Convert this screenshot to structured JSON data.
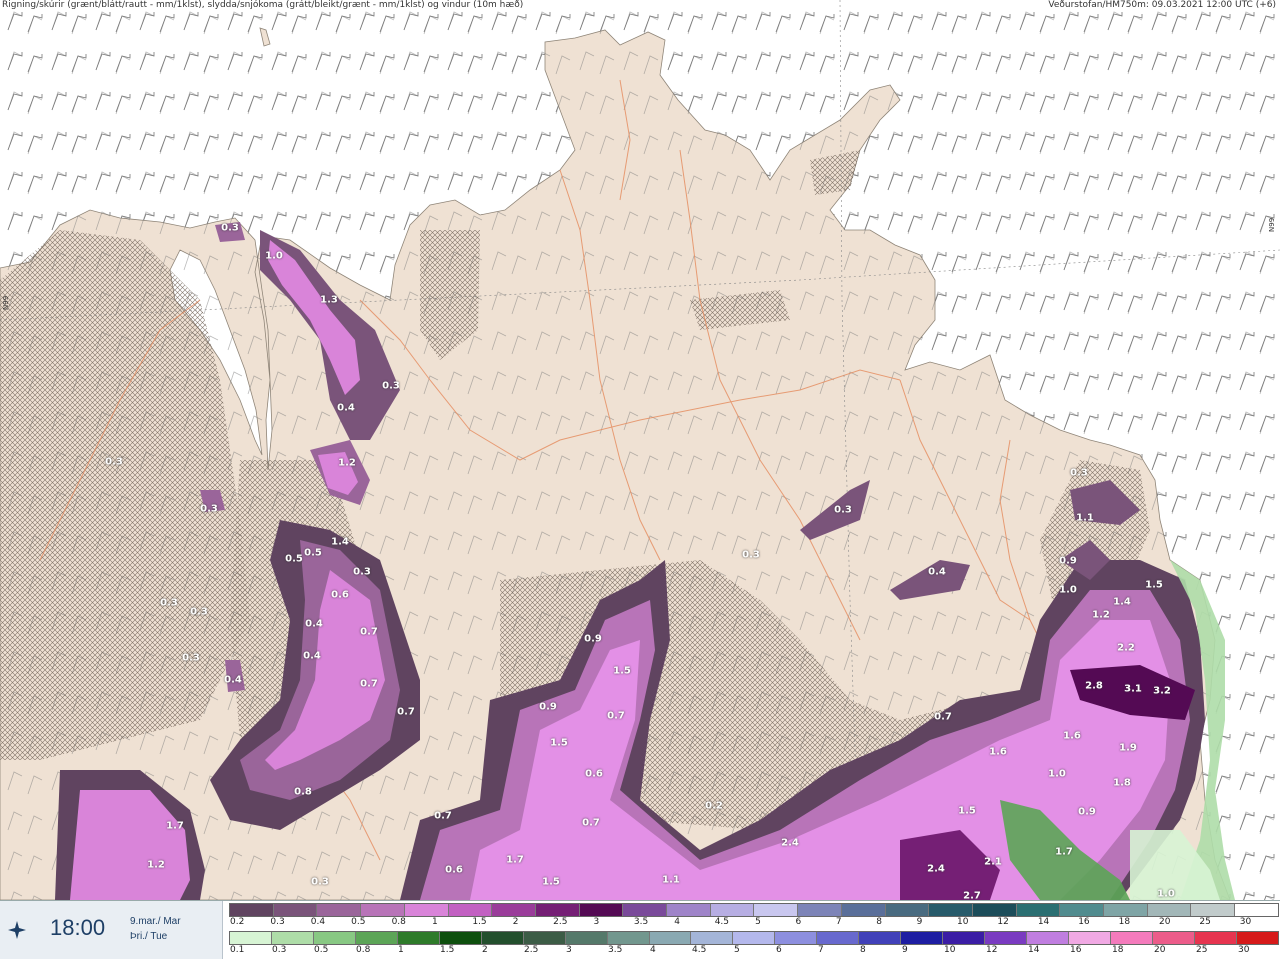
{
  "header": {
    "left_title": "Rigning/skúrir (grænt/blátt/rautt - mm/1klst), slydda/snjókoma (grátt/bleikt/grænt - mm/1klst) og vindur (10m hæð)",
    "right_title": "Veðurstofan/HM750m: 09.03.2021 12:00 UTC (+6)"
  },
  "map": {
    "lat_label_left": "N99",
    "lat_label_right": "N99",
    "land_color": "#efe1d3",
    "sea_color": "#ffffff",
    "precip_labels": [
      {
        "text": "0.3"
      },
      {
        "text": "1.0"
      },
      {
        "text": "1.3"
      },
      {
        "text": "0.3"
      },
      {
        "text": "0.4"
      },
      {
        "text": "1.2"
      },
      {
        "text": "0.3"
      },
      {
        "text": "0.3"
      },
      {
        "text": "0.5"
      },
      {
        "text": "0.5"
      },
      {
        "text": "1.4"
      },
      {
        "text": "0.3"
      },
      {
        "text": "0.6"
      },
      {
        "text": "0.3"
      },
      {
        "text": "0.3"
      },
      {
        "text": "0.4"
      },
      {
        "text": "0.4"
      },
      {
        "text": "0.7"
      },
      {
        "text": "0.3"
      },
      {
        "text": "0.4"
      },
      {
        "text": "0.7"
      },
      {
        "text": "0.7"
      },
      {
        "text": "0.8"
      },
      {
        "text": "1.7"
      },
      {
        "text": "1.2"
      },
      {
        "text": "0.3"
      },
      {
        "text": "0.9"
      },
      {
        "text": "1.5"
      },
      {
        "text": "0.9"
      },
      {
        "text": "0.7"
      },
      {
        "text": "1.5"
      },
      {
        "text": "0.6"
      },
      {
        "text": "0.7"
      },
      {
        "text": "0.7"
      },
      {
        "text": "0.6"
      },
      {
        "text": "1.7"
      },
      {
        "text": "1.5"
      },
      {
        "text": "1.1"
      },
      {
        "text": "0.2"
      },
      {
        "text": "0.3"
      },
      {
        "text": "0.3"
      },
      {
        "text": "0.4"
      },
      {
        "text": "0.3"
      },
      {
        "text": "1.1"
      },
      {
        "text": "0.9"
      },
      {
        "text": "1.0"
      },
      {
        "text": "1.5"
      },
      {
        "text": "1.4"
      },
      {
        "text": "1.2"
      },
      {
        "text": "2.2"
      },
      {
        "text": "2.8"
      },
      {
        "text": "3.1"
      },
      {
        "text": "3.2"
      },
      {
        "text": "0.7"
      },
      {
        "text": "1.6"
      },
      {
        "text": "1.6"
      },
      {
        "text": "1.9"
      },
      {
        "text": "1.0"
      },
      {
        "text": "1.8"
      },
      {
        "text": "1.5"
      },
      {
        "text": "0.9"
      },
      {
        "text": "2.4"
      },
      {
        "text": "2.1"
      },
      {
        "text": "1.7"
      },
      {
        "text": "2.4"
      },
      {
        "text": "2.7"
      },
      {
        "text": "1.0"
      }
    ]
  },
  "time_panel": {
    "icon": "wind-direction-icon",
    "time": "18:00",
    "date_line_1": "9.mar./ Mar",
    "date_line_2": "Þri./ Tue"
  },
  "legend": {
    "snow": {
      "colors": [
        "#604460",
        "#7a547a",
        "#9a659a",
        "#b874b8",
        "#d984d9",
        "#c260c2",
        "#9a3c9a",
        "#751f75",
        "#540a54",
        "#7a4a9a",
        "#9f84c9",
        "#b7aee3",
        "#c9c7ef",
        "#7d84b8",
        "#5a6f9a",
        "#496b80",
        "#275b6b",
        "#1c4d5a",
        "#2b6f72",
        "#518c8f",
        "#7fa5a6",
        "#a2b7b8",
        "#c1cbcb",
        "#ffffff"
      ],
      "ticks": [
        "0.2",
        "0.3",
        "0.4",
        "0.5",
        "0.8",
        "1",
        "1.5",
        "2",
        "2.5",
        "3",
        "3.5",
        "4",
        "4.5",
        "5",
        "6",
        "7",
        "8",
        "9",
        "10",
        "12",
        "14",
        "16",
        "18",
        "20",
        "25",
        "30"
      ]
    },
    "rain": {
      "colors": [
        "#d7f4d4",
        "#aedda8",
        "#88c883",
        "#5ca557",
        "#2e7b2a",
        "#0d4f0d",
        "#234f2d",
        "#3c5c46",
        "#55796a",
        "#72978e",
        "#8aa9b2",
        "#a4b5d8",
        "#b4b8ec",
        "#8d8fdf",
        "#6869ce",
        "#4141b9",
        "#1e1ea2",
        "#3b1da5",
        "#7a3bc1",
        "#c07ee0",
        "#f1a9e4",
        "#f47bbc",
        "#ec5c8a",
        "#e6344f",
        "#d61a1a"
      ],
      "ticks": [
        "0.1",
        "0.3",
        "0.5",
        "0.8",
        "1",
        "1.5",
        "2",
        "2.5",
        "3",
        "3.5",
        "4",
        "4.5",
        "5",
        "6",
        "7",
        "8",
        "9",
        "10",
        "12",
        "14",
        "16",
        "18",
        "20",
        "25",
        "30"
      ]
    }
  }
}
